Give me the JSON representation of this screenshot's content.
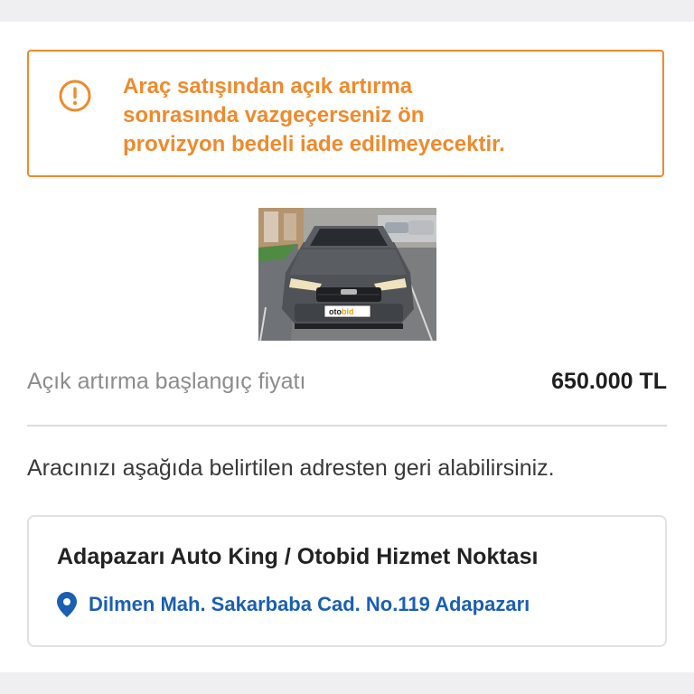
{
  "warning": {
    "icon": "exclamation-circle-icon",
    "lines": [
      "Araç satışından açık artırma",
      "sonrasında vazgeçerseniz ön",
      "provizyon bedeli iade edilmeyecektir."
    ],
    "color": "#f08a2c"
  },
  "car_image": {
    "plate_badge": {
      "part1": "oto",
      "part2": "bid"
    }
  },
  "price": {
    "label": "Açık artırma başlangıç fiyatı",
    "value": "650.000 TL"
  },
  "info": {
    "text": "Aracınızı aşağıda belirtilen adresten geri alabilirsiniz."
  },
  "address": {
    "title": "Adapazarı Auto King / Otobid Hizmet Noktası",
    "location": "Dilmen Mah. Sakarbaba Cad. No.119 Adapazarı",
    "icon": "location-pin-icon",
    "link_color": "#1a5fb4"
  }
}
